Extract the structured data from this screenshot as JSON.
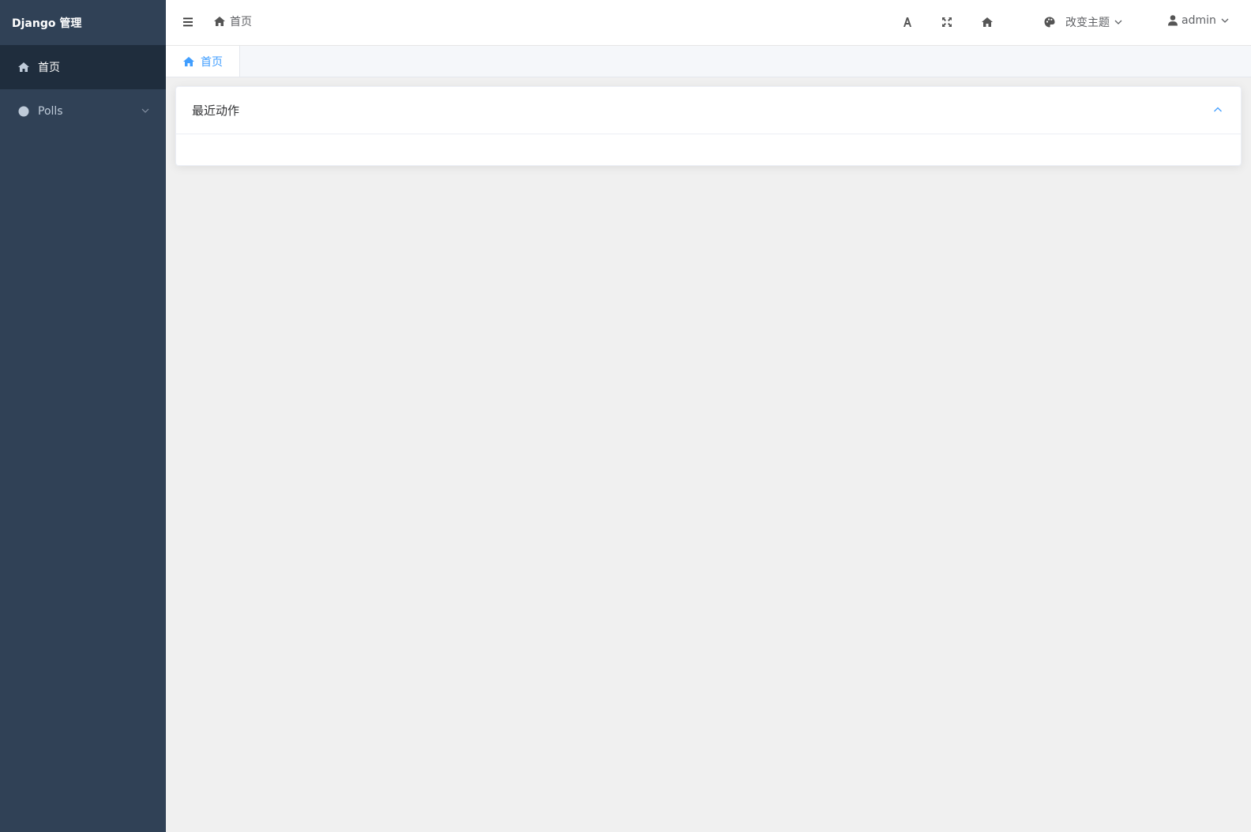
{
  "sidebar": {
    "brand": "Django 管理",
    "items": [
      {
        "label": "首页",
        "icon": "home-icon"
      },
      {
        "label": "Polls",
        "icon": "circle-icon"
      }
    ]
  },
  "header": {
    "breadcrumb": "首页",
    "theme_label": "改变主题",
    "user_label": "admin",
    "tools": [
      "font-size-icon",
      "fullscreen-icon",
      "home-icon"
    ]
  },
  "tabs": [
    {
      "label": "首页",
      "active": true
    }
  ],
  "card": {
    "title": "最近动作"
  },
  "colors": {
    "sidebar_bg": "#304156",
    "sidebar_active_bg": "#1f2d3d",
    "accent": "#409eff",
    "content_bg": "#f0f0f0"
  }
}
